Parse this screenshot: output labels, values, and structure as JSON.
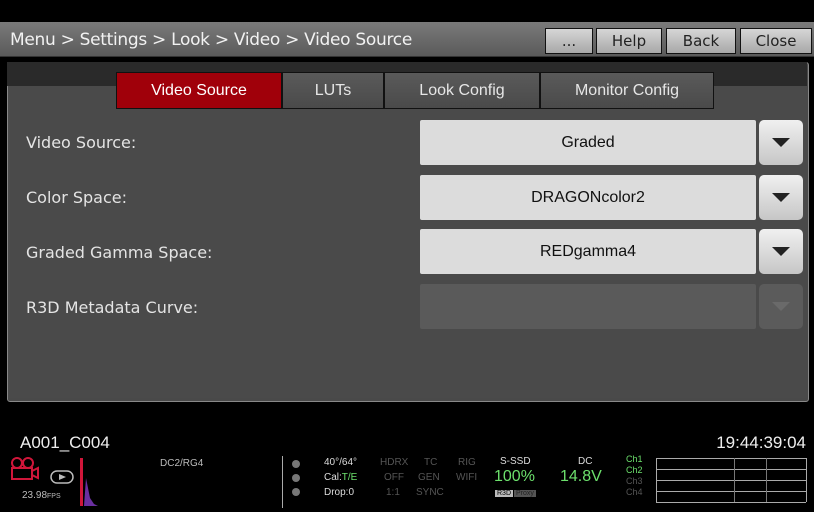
{
  "header": {
    "breadcrumb": "Menu > Settings > Look > Video > Video Source",
    "buttons": {
      "more": "...",
      "help": "Help",
      "back": "Back",
      "close": "Close"
    }
  },
  "tabs": [
    {
      "label": "Video Source",
      "active": true
    },
    {
      "label": "LUTs",
      "active": false
    },
    {
      "label": "Look Config",
      "active": false
    },
    {
      "label": "Monitor Config",
      "active": false
    }
  ],
  "settings": {
    "video_source": {
      "label": "Video Source:",
      "value": "Graded"
    },
    "color_space": {
      "label": "Color Space:",
      "value": "DRAGONcolor2"
    },
    "graded_gamma": {
      "label": "Graded Gamma Space:",
      "value": "REDgamma4"
    },
    "r3d_curve": {
      "label": "R3D Metadata Curve:",
      "value": ""
    }
  },
  "clip": {
    "name": "A001_C004",
    "timecode": "19:44:39:04"
  },
  "status": {
    "fps": "23.98",
    "fps_unit": "FPS",
    "look": "DC2/RG4",
    "shutter": "40°/64°",
    "cal_label": "Cal:",
    "cal_value": "T/E",
    "drop": "Drop:0",
    "hdrx_label": "HDRX",
    "hdrx_value": "OFF",
    "hdrx_ratio": "1:1",
    "tc_label": "TC",
    "tc_value": "GEN",
    "tc_sync": "SYNC",
    "rig_label": "RIG",
    "rig_value": "WIFI",
    "media_label": "S-SSD",
    "media_value": "100%",
    "media_badge_1": "R3D",
    "media_badge_2": "Proxy",
    "power_label": "DC",
    "power_value": "14.8V",
    "channels": [
      "Ch1",
      "Ch2",
      "Ch3",
      "Ch4"
    ]
  },
  "colors": {
    "active_tab": "#a0000a",
    "record_icon": "#d0163a",
    "green_text": "#6ce06c"
  }
}
